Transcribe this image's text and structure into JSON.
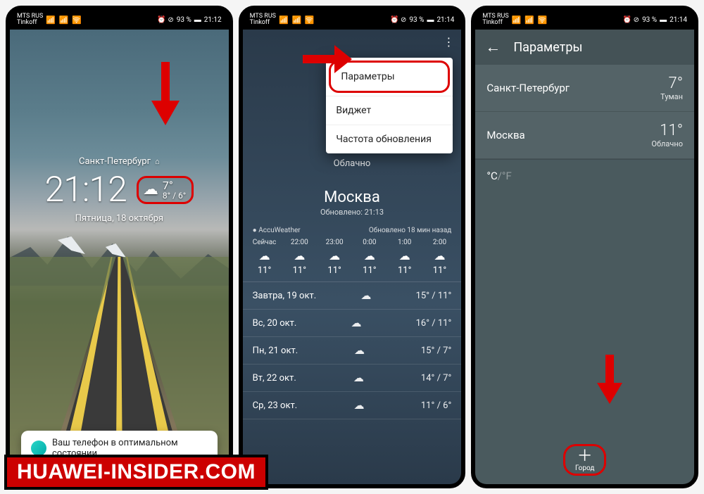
{
  "status": {
    "carrier1": "MTS RUS",
    "carrier2": "Tinkoff",
    "signal_icons": "📶 📶 🛜",
    "right_icons": "⏰ ⊘",
    "battery": "93 %",
    "time1": "21:12",
    "time2": "21:14",
    "time3": "21:14"
  },
  "phone1": {
    "city": "Санкт-Петербург",
    "clock": "21:12",
    "temp_now": "7°",
    "temp_range": "8° / 6°",
    "date": "Пятница, 18 октября",
    "notif": "Ваш телефон в оптимальном состоянии."
  },
  "phone2": {
    "menu": {
      "settings": "Параметры",
      "widget": "Виджет",
      "refresh": "Частота обновления"
    },
    "overcast": "Облачно",
    "city": "Москва",
    "updated": "Обновлено: 21:13",
    "provider": "AccuWeather",
    "provider_note": "Обновлено 18 мин назад",
    "hours": [
      {
        "label": "Сейчас",
        "temp": "11°"
      },
      {
        "label": "22:00",
        "temp": "11°"
      },
      {
        "label": "23:00",
        "temp": "11°"
      },
      {
        "label": "0:00",
        "temp": "11°"
      },
      {
        "label": "1:00",
        "temp": "11°"
      },
      {
        "label": "2:00",
        "temp": "11°"
      }
    ],
    "days": [
      {
        "label": "Завтра, 19 окт.",
        "hi": "15°",
        "lo": "11°"
      },
      {
        "label": "Вс, 20 окт.",
        "hi": "16°",
        "lo": "11°"
      },
      {
        "label": "Пн, 21 окт.",
        "hi": "15°",
        "lo": "7°"
      },
      {
        "label": "Вт, 22 окт.",
        "hi": "14°",
        "lo": "7°"
      },
      {
        "label": "Ср, 23 окт.",
        "hi": "11°",
        "lo": "6°"
      }
    ]
  },
  "phone3": {
    "title": "Параметры",
    "cities": [
      {
        "name": "Санкт-Петербург",
        "temp": "7°",
        "cond": "Туман"
      },
      {
        "name": "Москва",
        "temp": "11°",
        "cond": "Облачно"
      }
    ],
    "unit_c": "°C",
    "unit_f": "/°F",
    "add_label": "Город"
  },
  "watermark": "HUAWEI-INSIDER.COM"
}
